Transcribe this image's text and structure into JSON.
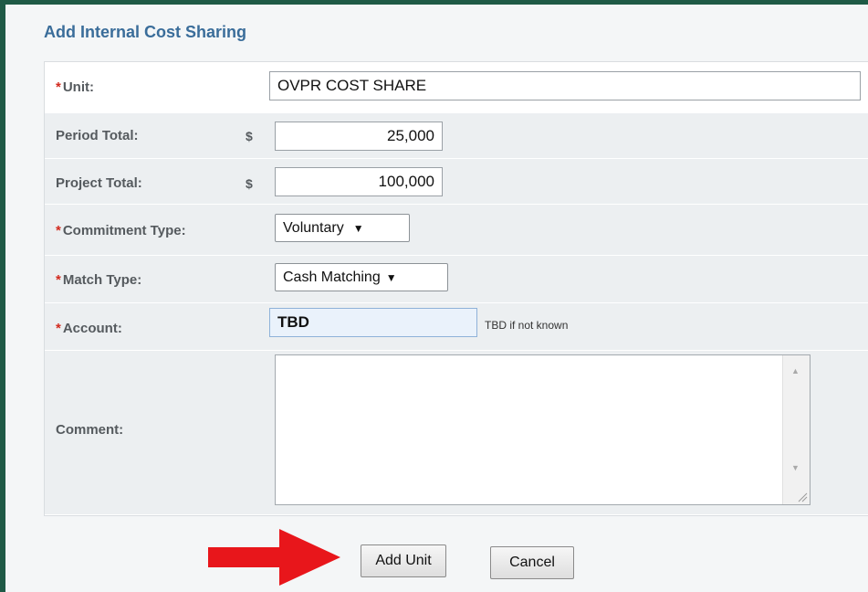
{
  "dialog": {
    "title": "Add Internal Cost Sharing"
  },
  "required_marker": "*",
  "fields": {
    "unit": {
      "label": "Unit:",
      "value": "OVPR COST SHARE"
    },
    "period_total": {
      "label": "Period Total:",
      "currency": "$",
      "value": "25,000"
    },
    "project_total": {
      "label": "Project Total:",
      "currency": "$",
      "value": "100,000"
    },
    "commitment_type": {
      "label": "Commitment Type:",
      "selected": "Voluntary"
    },
    "match_type": {
      "label": "Match Type:",
      "selected": "Cash Matching"
    },
    "account": {
      "label": "Account:",
      "value": "TBD",
      "hint": "TBD if not known"
    },
    "comment": {
      "label": "Comment:",
      "value": ""
    }
  },
  "buttons": {
    "add_unit": "Add Unit",
    "cancel": "Cancel"
  },
  "colors": {
    "frame_border": "#1f5a46",
    "title": "#3a6d9a",
    "required": "#d22a1e",
    "arrow": "#e8161b",
    "account_input_bg": "#eaf2fb"
  }
}
